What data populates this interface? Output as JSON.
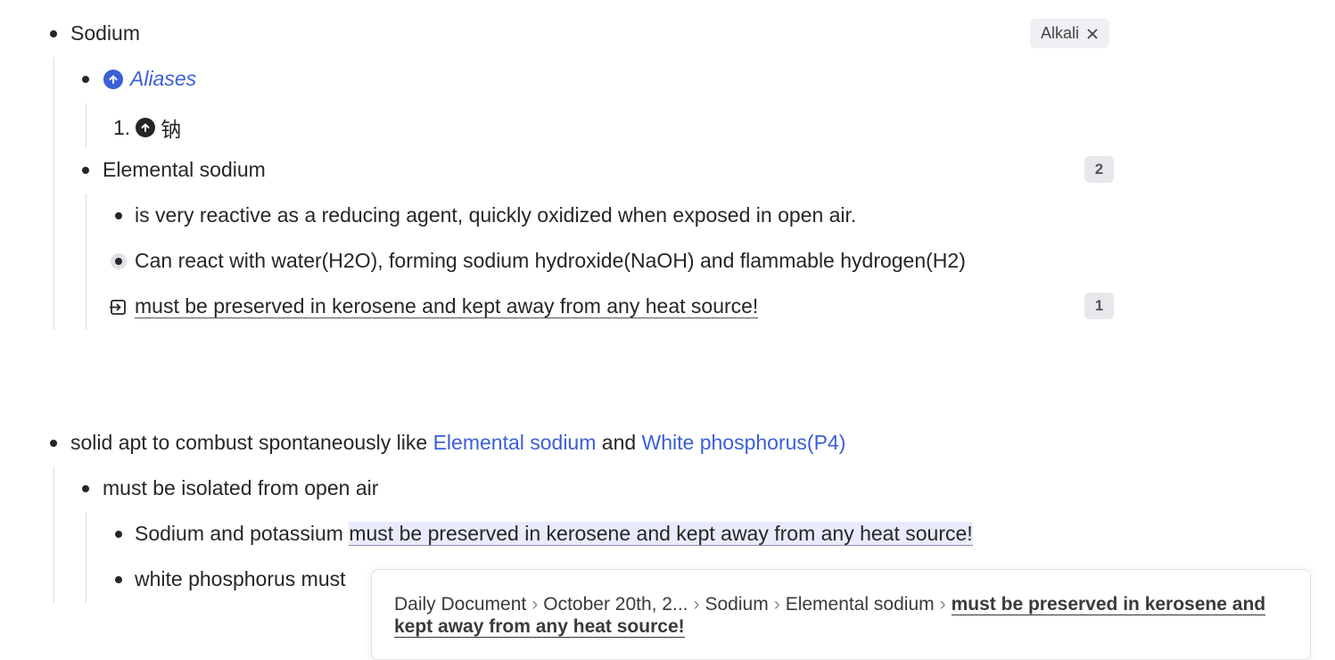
{
  "outline": {
    "sodium": {
      "title": "Sodium",
      "tag": "Alkali",
      "aliases_label": "Aliases",
      "alias_number": "1.",
      "alias_value": "钠",
      "elemental": {
        "title": "Elemental sodium",
        "count": "2",
        "child1": "is very reactive as a reducing agent, quickly oxidized when exposed in open air.",
        "child2": "Can react with water(H2O), forming sodium hydroxide(NaOH) and flammable hydrogen(H2)",
        "child3": "must be preserved in kerosene and kept away from any heat source!",
        "child3_count": "1"
      }
    },
    "solid": {
      "prefix": "solid apt to combust spontaneously like ",
      "link1": "Elemental sodium",
      "middle": " and ",
      "link2": "White phosphorus(P4)",
      "isolated": "must be isolated from open air",
      "sodium_prefix": "Sodium and potassium ",
      "sodium_ref": "must be preserved in kerosene and kept away from any heat source!",
      "white_prefix": "white phosphorus must"
    }
  },
  "popover": {
    "crumbs": [
      "Daily Document",
      "October 20th, 2...",
      "Sodium",
      "Elemental sodium"
    ],
    "current": "must be preserved in kerosene and kept away from any heat source!"
  },
  "colors": {
    "link": "#3b5fd6",
    "highlight": "#e8ebfb"
  },
  "icons": {
    "alias_icon": "arrow-up-circle-icon",
    "ref_icon": "embed-arrow-icon",
    "close": "close-icon"
  }
}
